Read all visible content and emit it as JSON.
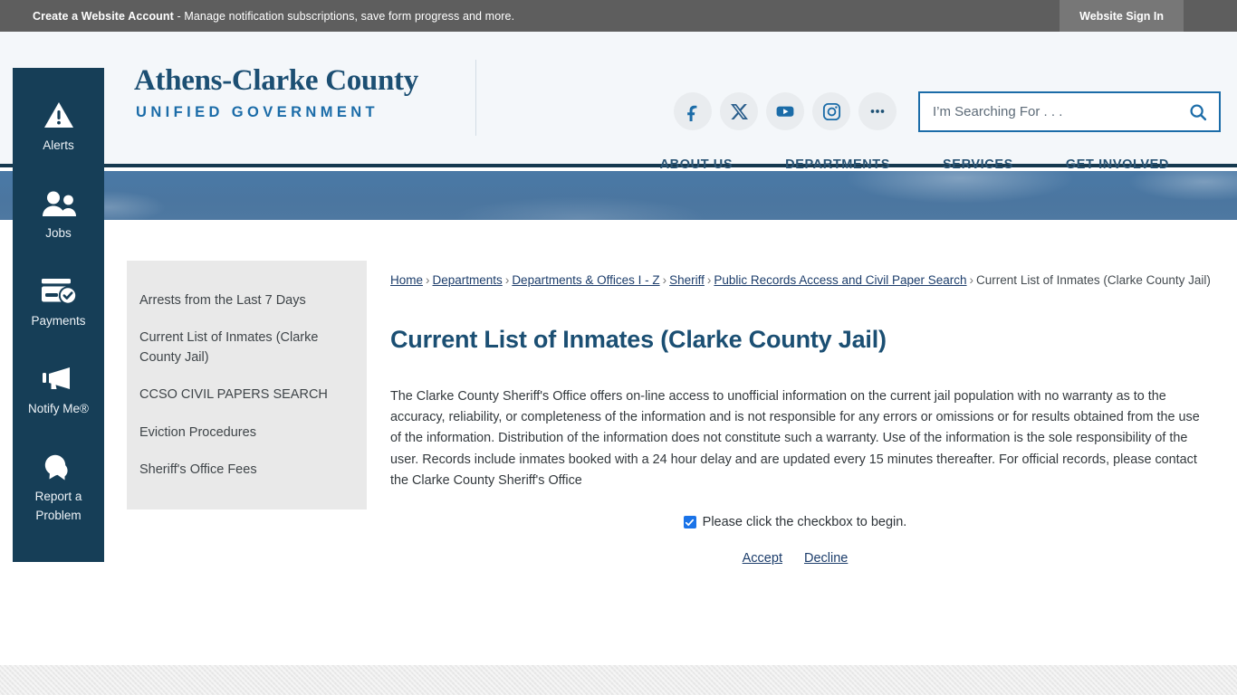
{
  "topbar": {
    "message_strong": "Create a Website Account",
    "message_rest": " - Manage notification subscriptions, save form progress and more.",
    "signin_label": "Website Sign In"
  },
  "header": {
    "logo_main": "Athens-Clarke County",
    "logo_sub": "UNIFIED GOVERNMENT",
    "social": [
      {
        "name": "facebook-icon",
        "label": "Facebook"
      },
      {
        "name": "x-twitter-icon",
        "label": "X"
      },
      {
        "name": "youtube-icon",
        "label": "YouTube"
      },
      {
        "name": "instagram-icon",
        "label": "Instagram"
      },
      {
        "name": "more-icon",
        "label": "More"
      }
    ],
    "search": {
      "placeholder": "I’m Searching For . . .",
      "value": ""
    },
    "nav": [
      {
        "label": "ABOUT US"
      },
      {
        "label": "DEPARTMENTS"
      },
      {
        "label": "SERVICES"
      },
      {
        "label": "GET INVOLVED"
      }
    ]
  },
  "sidebar": {
    "items": [
      {
        "label": "Alerts",
        "icon": "alert-triangle-icon"
      },
      {
        "label": "Jobs",
        "icon": "people-icon"
      },
      {
        "label": "Payments",
        "icon": "credit-card-check-icon"
      },
      {
        "label": "Notify Me®",
        "icon": "megaphone-icon"
      },
      {
        "label": "Report a Problem",
        "icon": "chat-bubbles-icon"
      }
    ]
  },
  "leftnav": {
    "items": [
      {
        "label": "Arrests from the Last 7 Days"
      },
      {
        "label": "Current List of Inmates (Clarke County Jail)"
      },
      {
        "label": "CCSO CIVIL PAPERS SEARCH"
      },
      {
        "label": "Eviction Procedures"
      },
      {
        "label": "Sheriff's Office Fees"
      }
    ]
  },
  "main": {
    "breadcrumb": [
      {
        "label": "Home",
        "link": true
      },
      {
        "label": "Departments",
        "link": true
      },
      {
        "label": "Departments & Offices I - Z",
        "link": true
      },
      {
        "label": "Sheriff",
        "link": true
      },
      {
        "label": "Public Records Access and Civil Paper Search",
        "link": true
      },
      {
        "label": "Current List of Inmates (Clarke County Jail)",
        "link": false
      }
    ],
    "breadcrumb_separator": "›",
    "page_title": "Current List of Inmates (Clarke County Jail)",
    "body_text": "The Clarke County Sheriff's Office offers on-line access to unofficial information on the current jail population with no warranty as to the accuracy, reliability, or completeness of the information and is not responsible for any errors or omissions or for results obtained from the use of the information. Distribution of the information does not constitute such a warranty. Use of the information is the sole responsibility of the user. Records include inmates booked with a 24 hour delay and are updated every 15 minutes thereafter. For official records, please contact the Clarke County Sheriff's Office",
    "consent": {
      "checkbox_checked": true,
      "checkbox_label": "Please click the checkbox to begin.",
      "accept_label": "Accept",
      "decline_label": "Decline"
    }
  },
  "colors": {
    "brand_navy": "#163e57",
    "brand_blue": "#1b6ca8",
    "title_blue": "#1b4f73",
    "banner_blue": "#4b76a0",
    "topbar_gray": "#5e5e5e",
    "link_blue": "#1c3d6b",
    "checkbox_blue": "#1a73e8"
  }
}
